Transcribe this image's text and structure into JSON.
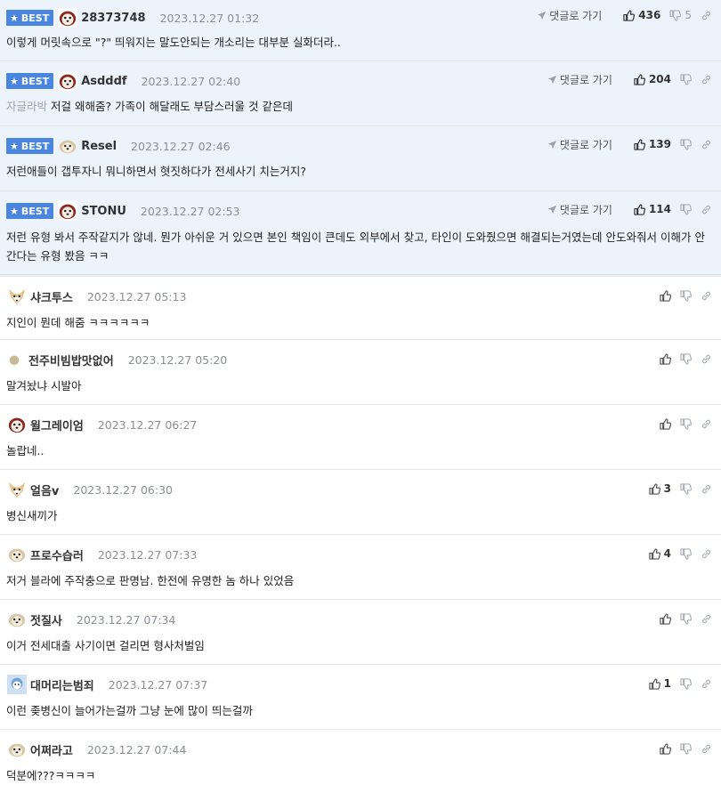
{
  "best_label": "BEST",
  "reply_label": "댓글로 가기",
  "comments": [
    {
      "nick": "28373748",
      "date": "2023.12.27 01:32",
      "text": "이렇게 머릿속으로 \"?\" 띄워지는 말도안되는 개소리는 대부분 실화더라..",
      "up": "436",
      "down": "5"
    },
    {
      "nick": "Asdddf",
      "date": "2023.12.27 02:40",
      "tag": "자글라박",
      "text": "저걸 왜해줌? 가족이 해달래도 부담스러울 것 같은데",
      "up": "204"
    },
    {
      "nick": "Resel",
      "date": "2023.12.27 02:46",
      "text": "저런애들이 갭투자니 뭐니하면서 혓짓하다가 전세사기 치는거지?",
      "up": "139"
    },
    {
      "nick": "STONU",
      "date": "2023.12.27 02:53",
      "text": "저런 유형 봐서 주작같지가 않네. 뭔가 아쉬운 거 있으면 본인 책임이 큰데도 외부에서 찾고, 타인이 도와줬으면 해결되는거였는데 안도와줘서 이해가 안간다는 유형 봤음 ㅋㅋ",
      "up": "114"
    },
    {
      "nick": "샤크투스",
      "date": "2023.12.27 05:13",
      "text": "지인이 뭔데 해줌 ㅋㅋㅋㅋㅋㅋ"
    },
    {
      "nick": "전주비빔밥맛없어",
      "date": "2023.12.27 05:20",
      "text": "말겨놨냐 시발아"
    },
    {
      "nick": "윌그레이엄",
      "date": "2023.12.27 06:27",
      "text": "놀랍네.."
    },
    {
      "nick": "얼음v",
      "date": "2023.12.27 06:30",
      "text": "병신새끼가",
      "up": "3"
    },
    {
      "nick": "프로수습러",
      "date": "2023.12.27 07:33",
      "text": "저거 블라에 주작충으로 판명남. 한전에 유명한 놈 하나 있었음",
      "up": "4"
    },
    {
      "nick": "젓질사",
      "date": "2023.12.27 07:34",
      "text": "이거 전세대출 사기이면 걸리면 형사처벌임"
    },
    {
      "nick": "대머리는범죄",
      "date": "2023.12.27 07:37",
      "text": "이런 좆병신이 늘어가는걸까 그냥 눈에 많이 띄는걸까",
      "up": "1"
    },
    {
      "nick": "어쩌라고",
      "date": "2023.12.27 07:44",
      "text": "덕분에???ㅋㅋㅋㅋ"
    }
  ]
}
